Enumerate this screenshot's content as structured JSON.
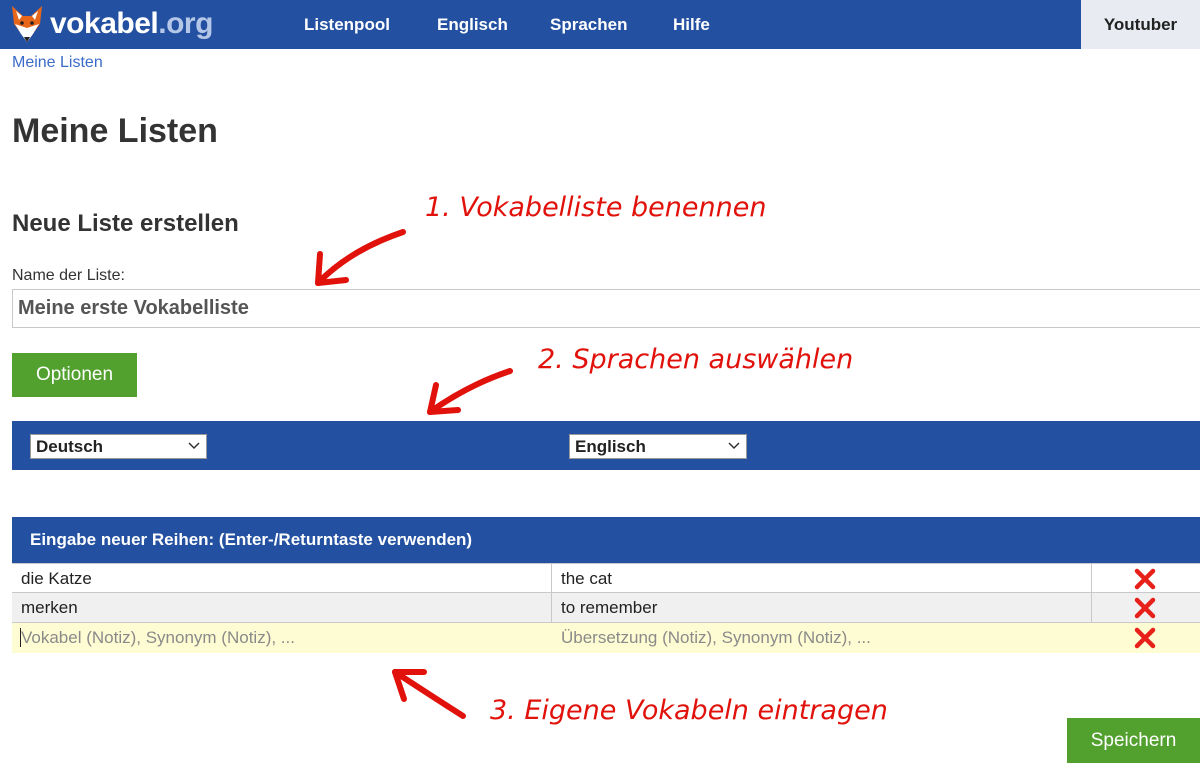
{
  "navbar": {
    "logo_main": "vokabel",
    "logo_tld": ".org",
    "items": [
      {
        "label": "Listenpool"
      },
      {
        "label": "Englisch"
      },
      {
        "label": "Sprachen"
      },
      {
        "label": "Hilfe"
      }
    ],
    "youtuber_label": "Youtuber"
  },
  "breadcrumb": {
    "label": "Meine Listen"
  },
  "page_title": "Meine Listen",
  "new_list": {
    "section_title": "Neue Liste erstellen",
    "name_label": "Name der Liste:",
    "name_value": "Meine erste Vokabelliste",
    "options_button": "Optionen"
  },
  "languages": {
    "source": "Deutsch",
    "target": "Englisch"
  },
  "entry_table": {
    "header": "Eingabe neuer Reihen: (Enter-/Returntaste verwenden)",
    "rows": [
      {
        "term": "die Katze",
        "translation": "the cat"
      },
      {
        "term": "merken",
        "translation": "to remember"
      }
    ],
    "new_row": {
      "term_placeholder": "Vokabel (Notiz), Synonym (Notiz), ...",
      "translation_placeholder": "Übersetzung (Notiz), Synonym (Notiz), ..."
    }
  },
  "save_button": "Speichern",
  "annotations": [
    "1. Vokabelliste benennen",
    "2. Sprachen auswählen",
    "3. Eigene Vokabeln eintragen"
  ],
  "colors": {
    "nav_blue": "#2350a0",
    "button_green": "#52a02e",
    "delete_red": "#e8201a",
    "annotation_red": "#e0120b",
    "new_row_yellow": "#fefcd2"
  },
  "icons": {
    "logo": "fox-head-icon",
    "delete": "red-x-icon",
    "select": "chevron-down-icon"
  }
}
